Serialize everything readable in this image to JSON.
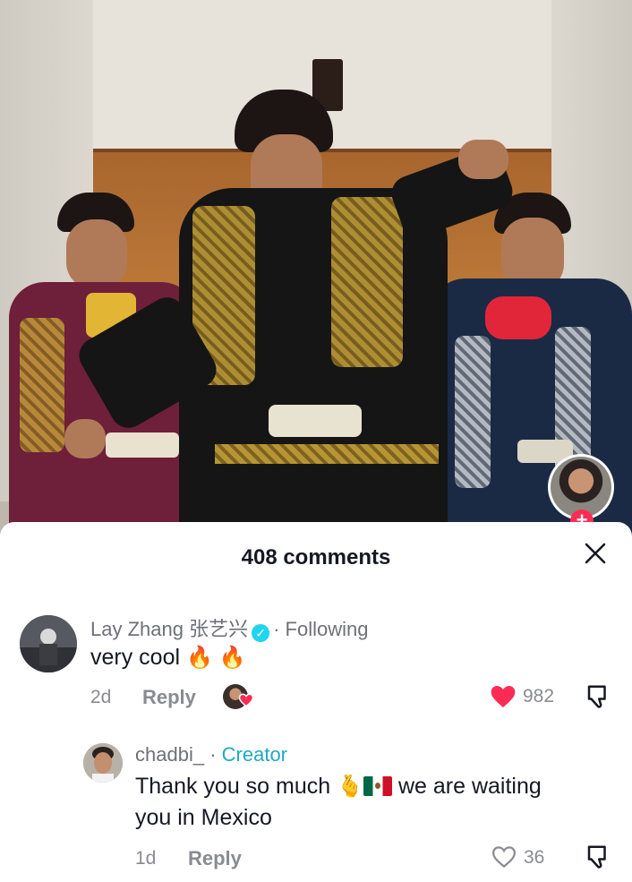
{
  "sheet": {
    "title": "408 comments"
  },
  "comments": [
    {
      "username": "Lay Zhang 张艺兴",
      "verified": true,
      "status": "Following",
      "text": "very cool",
      "emoji": "🔥 🔥",
      "age": "2d",
      "reply_label": "Reply",
      "likes": "982",
      "liked": true
    }
  ],
  "replies": [
    {
      "username": "chadbi_",
      "badge": "Creator",
      "text_before": "Thank you so much",
      "emoji": "🫰",
      "text_after": "we are waiting",
      "text_line2": "you in Mexico",
      "age": "1d",
      "reply_label": "Reply",
      "likes": "36",
      "liked": false
    }
  ],
  "colors": {
    "accent_red": "#fe2c55",
    "creator_teal": "#20a8c4",
    "verified_blue": "#20d5ec"
  },
  "icons": [
    "close-icon",
    "heart-icon",
    "dislike-icon",
    "verified-icon",
    "fire-icon",
    "plus-icon"
  ]
}
